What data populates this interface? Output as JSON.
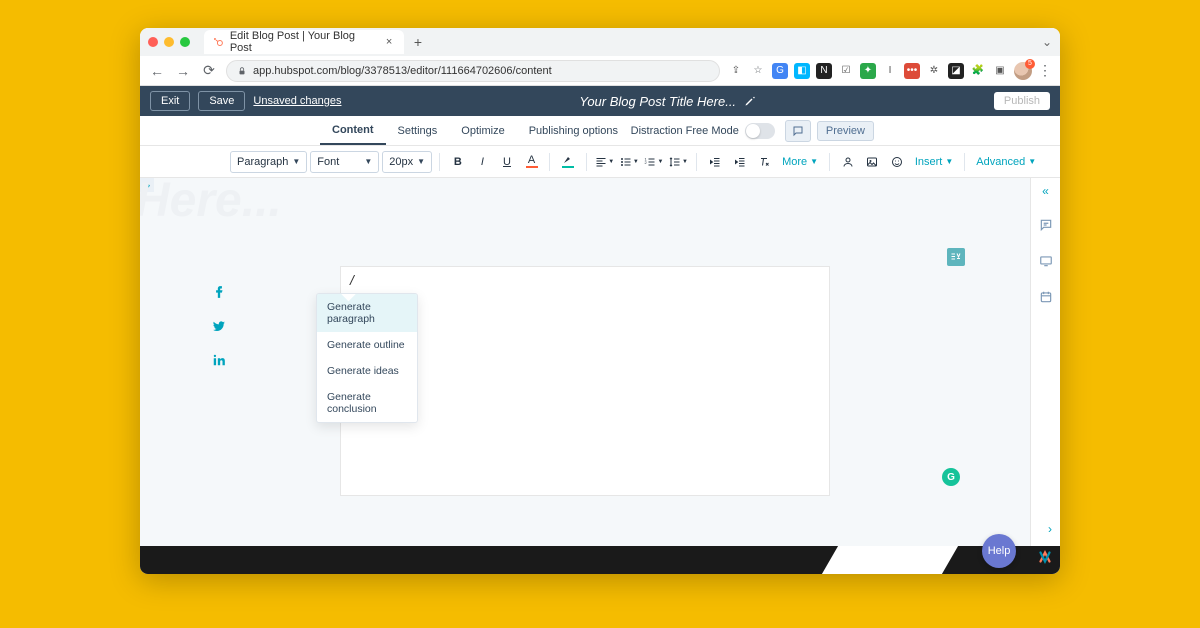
{
  "browser": {
    "tab_title": "Edit Blog Post | Your Blog Post",
    "url": "app.hubspot.com/blog/3378513/editor/111664702606/content",
    "avatar_badge": "5"
  },
  "appbar": {
    "exit": "Exit",
    "save": "Save",
    "unsaved": "Unsaved changes",
    "title": "Your Blog Post Title Here...",
    "publish": "Publish"
  },
  "tabs": {
    "content": "Content",
    "settings": "Settings",
    "optimize": "Optimize",
    "publishing": "Publishing options",
    "dfm": "Distraction Free Mode",
    "preview": "Preview"
  },
  "toolbar": {
    "style": "Paragraph",
    "font": "Font",
    "size": "20px",
    "more": "More",
    "insert": "Insert",
    "advanced": "Advanced"
  },
  "canvas": {
    "faded_text": "Here...",
    "slash_trigger": "/"
  },
  "slash_menu": {
    "items": [
      "Generate paragraph",
      "Generate outline",
      "Generate ideas",
      "Generate conclusion"
    ]
  },
  "help": "Help"
}
